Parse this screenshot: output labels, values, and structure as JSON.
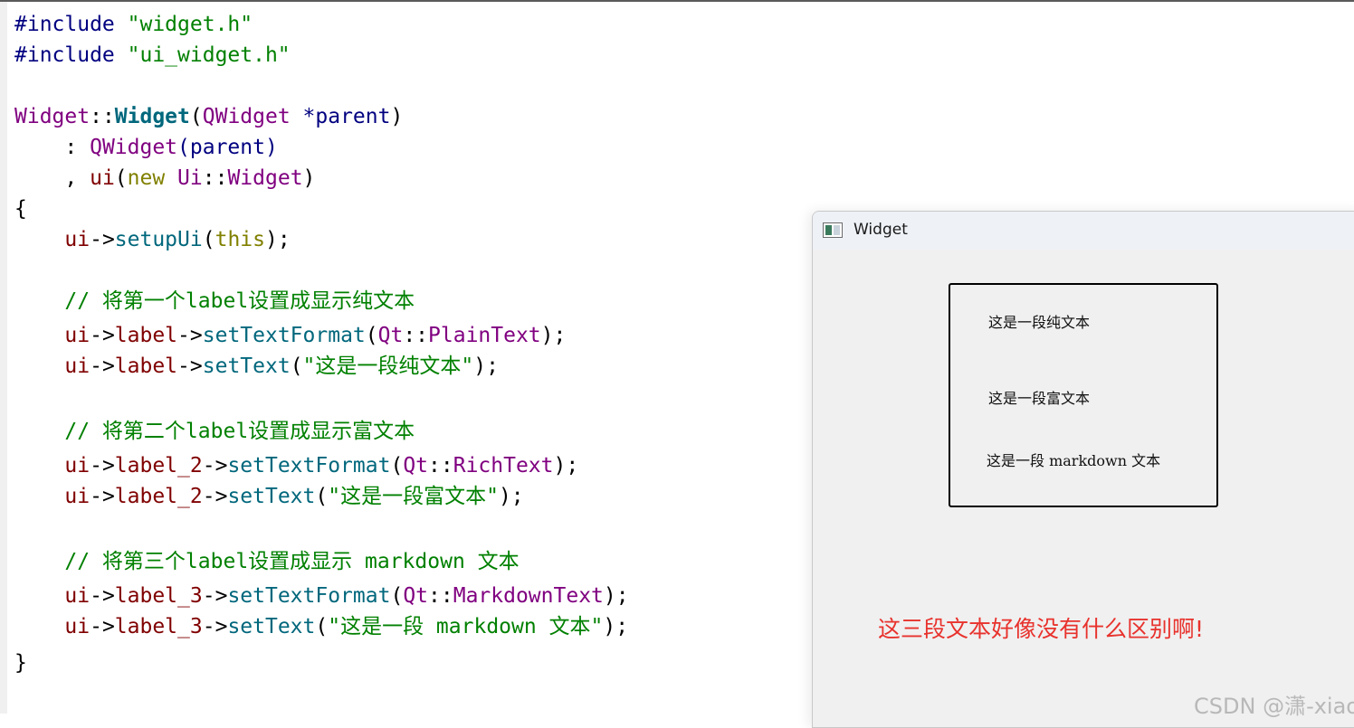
{
  "code": {
    "l1": {
      "directive": "#include",
      "file": "\"widget.h\""
    },
    "l2": {
      "directive": "#include",
      "file": "\"ui_widget.h\""
    },
    "l4": {
      "class": "Widget",
      "scope": "::",
      "ctor": "Widget",
      "open": "(",
      "param_type": "QWidget",
      "param": " *parent",
      "close": ")"
    },
    "l5": {
      "lead": "    : ",
      "base": "QWidget",
      "args": "(parent)"
    },
    "l6": {
      "lead": "    , ",
      "member": "ui",
      "open": "(",
      "kw_new": "new",
      "ns": " Ui",
      "scope": "::",
      "cls": "Widget",
      "close": ")"
    },
    "l7": {
      "brace": "{"
    },
    "l8": {
      "lead": "    ",
      "obj": "ui",
      "arrow": "->",
      "fn": "setupUi",
      "open": "(",
      "arg": "this",
      "close": ");"
    },
    "c1": "    // 将第一个label设置成显示纯文本",
    "l11": {
      "lead": "    ",
      "obj": "ui",
      "arrow": "->",
      "label": "label",
      "arrow2": "->",
      "fn": "setTextFormat",
      "open": "(",
      "ns": "Qt",
      "scope": "::",
      "enum": "PlainText",
      "close": ");"
    },
    "l12": {
      "lead": "    ",
      "obj": "ui",
      "arrow": "->",
      "label": "label",
      "arrow2": "->",
      "fn": "setText",
      "open": "(",
      "str": "\"这是一段纯文本\"",
      "close": ");"
    },
    "c2": "    // 将第二个label设置成显示富文本",
    "l15": {
      "lead": "    ",
      "obj": "ui",
      "arrow": "->",
      "label": "label_2",
      "arrow2": "->",
      "fn": "setTextFormat",
      "open": "(",
      "ns": "Qt",
      "scope": "::",
      "enum": "RichText",
      "close": ");"
    },
    "l16": {
      "lead": "    ",
      "obj": "ui",
      "arrow": "->",
      "label": "label_2",
      "arrow2": "->",
      "fn": "setText",
      "open": "(",
      "str": "\"这是一段富文本\"",
      "close": ");"
    },
    "c3": "    // 将第三个label设置成显示 markdown 文本",
    "l19": {
      "lead": "    ",
      "obj": "ui",
      "arrow": "->",
      "label": "label_3",
      "arrow2": "->",
      "fn": "setTextFormat",
      "open": "(",
      "ns": "Qt",
      "scope": "::",
      "enum": "MarkdownText",
      "close": ");"
    },
    "l20": {
      "lead": "    ",
      "obj": "ui",
      "arrow": "->",
      "label": "label_3",
      "arrow2": "->",
      "fn": "setText",
      "open": "(",
      "str": "\"这是一段 markdown 文本\"",
      "close": ");"
    },
    "l21": {
      "brace": "}"
    }
  },
  "window": {
    "title": "Widget",
    "labels": [
      "这是一段纯文本",
      "这是一段富文本",
      "这是一段 markdown 文本"
    ]
  },
  "note": "这三段文本好像没有什么区别啊!",
  "watermark": "CSDN @潇-xiao",
  "icons": {
    "app": "qt-window-icon"
  }
}
